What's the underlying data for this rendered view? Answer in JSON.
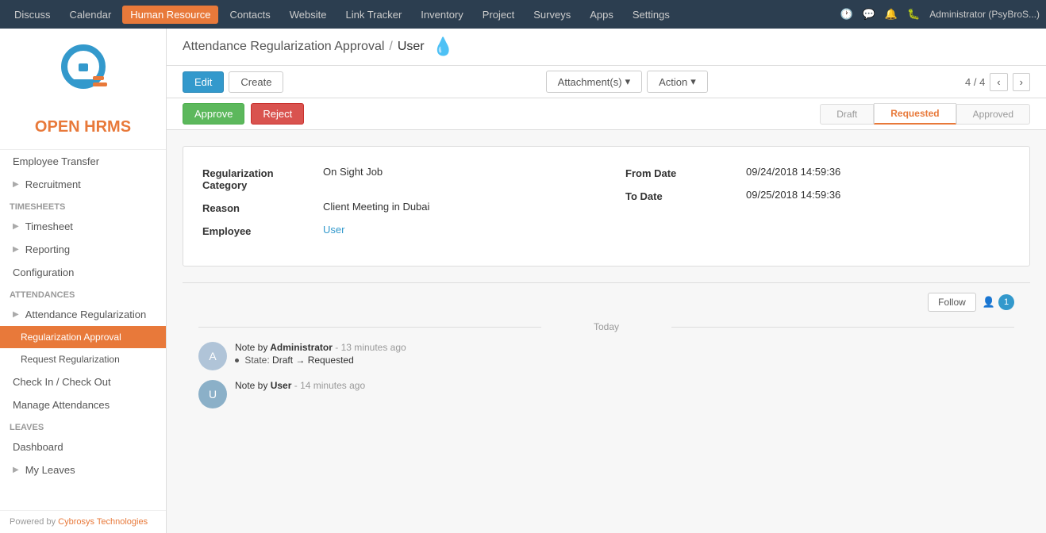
{
  "topnav": {
    "items": [
      {
        "label": "Discuss",
        "active": false
      },
      {
        "label": "Calendar",
        "active": false
      },
      {
        "label": "Human Resource",
        "active": true
      },
      {
        "label": "Contacts",
        "active": false
      },
      {
        "label": "Website",
        "active": false
      },
      {
        "label": "Link Tracker",
        "active": false
      },
      {
        "label": "Inventory",
        "active": false
      },
      {
        "label": "Project",
        "active": false
      },
      {
        "label": "Surveys",
        "active": false
      },
      {
        "label": "Apps",
        "active": false
      },
      {
        "label": "Settings",
        "active": false
      }
    ],
    "user": "Administrator (PsyBroS...)"
  },
  "sidebar": {
    "logo_line1": "OPEN",
    "logo_line2": "HRMS",
    "sections": [
      {
        "type": "item",
        "label": "Employee Transfer",
        "active": false,
        "has_arrow": false
      },
      {
        "type": "item",
        "label": "Recruitment",
        "active": false,
        "has_arrow": true
      }
    ],
    "timesheets_label": "Timesheets",
    "timesheet_items": [
      {
        "label": "Timesheet",
        "has_arrow": true
      },
      {
        "label": "Reporting",
        "has_arrow": true
      },
      {
        "label": "Configuration",
        "has_arrow": false
      }
    ],
    "attendances_label": "Attendances",
    "attendance_items": [
      {
        "label": "Attendance Regularization",
        "has_arrow": true,
        "sub": false
      },
      {
        "label": "Regularization Approval",
        "active": true,
        "sub": true
      },
      {
        "label": "Request Regularization",
        "active": false,
        "sub": true
      },
      {
        "label": "Check In / Check Out",
        "active": false,
        "sub": false
      },
      {
        "label": "Manage Attendances",
        "active": false,
        "sub": false
      }
    ],
    "leaves_label": "Leaves",
    "leaves_items": [
      {
        "label": "Dashboard",
        "active": false
      },
      {
        "label": "My Leaves",
        "active": false,
        "has_arrow": true
      }
    ],
    "footer_text": "Powered by ",
    "footer_link": "Cybrosys Technologies"
  },
  "breadcrumb": {
    "parent": "Attendance Regularization Approval",
    "current": "User"
  },
  "toolbar": {
    "edit_label": "Edit",
    "create_label": "Create",
    "attachments_label": "Attachment(s)",
    "action_label": "Action",
    "pagination": "4 / 4"
  },
  "statusbar": {
    "approve_label": "Approve",
    "reject_label": "Reject",
    "stages": [
      {
        "label": "Draft",
        "active": false
      },
      {
        "label": "Requested",
        "active": true
      },
      {
        "label": "Approved",
        "active": false
      }
    ]
  },
  "form": {
    "fields": [
      {
        "label": "Regularization Category",
        "value": "On Sight Job",
        "left": true
      },
      {
        "label": "From Date",
        "value": "09/24/2018 14:59:36",
        "left": false
      },
      {
        "label": "Reason",
        "value": "Client Meeting in Dubai",
        "left": true
      },
      {
        "label": "To Date",
        "value": "09/25/2018 14:59:36",
        "left": false
      },
      {
        "label": "Employee",
        "value": "User",
        "is_link": true,
        "left": true
      }
    ]
  },
  "chatter": {
    "follow_label": "Follow",
    "follower_count": "1",
    "today_label": "Today",
    "messages": [
      {
        "author": "Administrator",
        "time": "13 minutes ago",
        "prefix": "Note by",
        "state_change": "Draft → Requested",
        "avatar_text": "A"
      },
      {
        "author": "User",
        "time": "14 minutes ago",
        "prefix": "Note by",
        "avatar_text": "U"
      }
    ]
  }
}
